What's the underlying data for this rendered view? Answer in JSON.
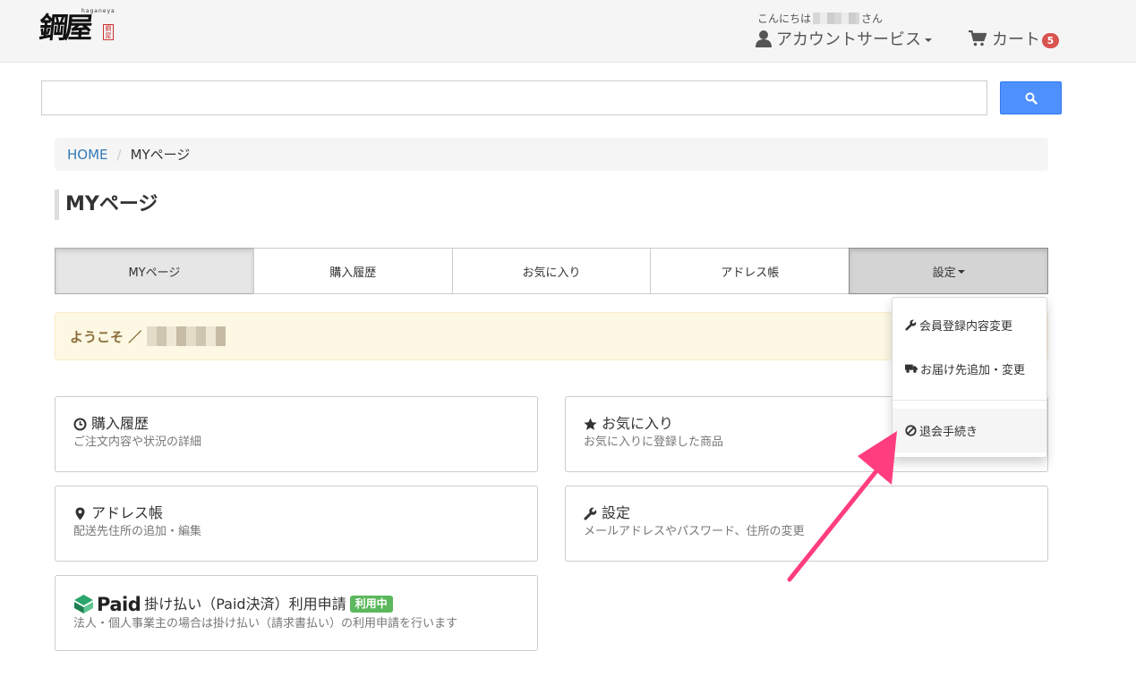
{
  "header": {
    "logo_text": "鋼屋",
    "logo_sub": "haganeya",
    "logo_seal": "鋼屋",
    "greeting_prefix": "こんにちは",
    "greeting_suffix": "さん",
    "account_label": "アカウントサービス",
    "cart_label": "カート",
    "cart_count": "5"
  },
  "search": {
    "value": "",
    "placeholder": ""
  },
  "breadcrumb": {
    "home": "HOME",
    "separator": "/",
    "current": "MYページ"
  },
  "page_title": "MYページ",
  "tabs": [
    {
      "label": "MYページ"
    },
    {
      "label": "購入履歴"
    },
    {
      "label": "お気に入り"
    },
    {
      "label": "アドレス帳"
    },
    {
      "label": "設定"
    }
  ],
  "welcome": {
    "text": "ようこそ ／"
  },
  "cards": {
    "history": {
      "title": "購入履歴",
      "desc": "ご注文内容や状況の詳細",
      "icon": "clock-icon"
    },
    "favorites": {
      "title": "お気に入り",
      "desc": "お気に入りに登録した商品",
      "icon": "star-icon"
    },
    "address": {
      "title": "アドレス帳",
      "desc": "配送先住所の追加・編集",
      "icon": "map-marker-icon"
    },
    "settings": {
      "title": "設定",
      "desc": "メールアドレスやパスワード、住所の変更",
      "icon": "wrench-icon"
    },
    "paid": {
      "logo_text": "Paid",
      "title": "掛け払い（Paid決済）利用申請",
      "badge": "利用中",
      "desc": "法人・個人事業主の場合は掛け払い（請求書払い）の利用申請を行います"
    }
  },
  "dropdown": {
    "items": [
      {
        "label": "会員登録内容変更",
        "icon": "wrench-icon"
      },
      {
        "label": "お届け先追加・変更",
        "icon": "truck-icon"
      },
      {
        "label": "退会手続き",
        "icon": "ban-icon"
      }
    ]
  },
  "colors": {
    "link": "#337ab7",
    "search_button": "#4d90fe",
    "badge_red": "#d9534f",
    "status_green": "#5cb85c",
    "annotation_arrow": "#ff3d7f",
    "welcome_bg": "#fcf8e3",
    "welcome_text": "#8a6d3b"
  }
}
